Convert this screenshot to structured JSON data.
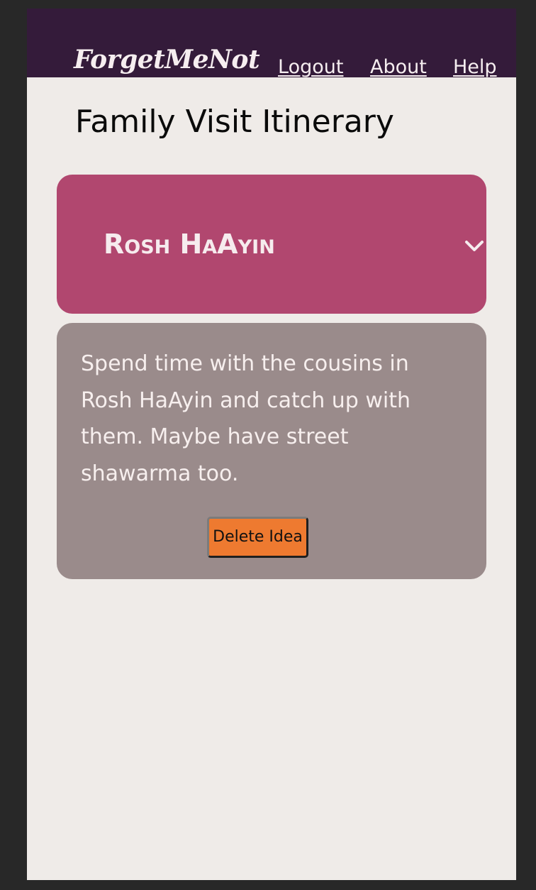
{
  "header": {
    "brand": "ForgetMeNot",
    "nav": {
      "logout": "Logout",
      "about": "About",
      "help": "Help"
    }
  },
  "page": {
    "title": "Family Visit Itinerary"
  },
  "accordion": {
    "title": "Rosh HaAyin",
    "icon": "chevron-down-icon",
    "expanded": true,
    "body_text": "Spend time with the cousins in Rosh HaAyin and catch up with them. Maybe have street shawarma too.",
    "delete_label": "Delete Idea"
  },
  "colors": {
    "navbar": "#341b3a",
    "page_background": "#efebe8",
    "accordion_header": "#b1476f",
    "accordion_body": "#9a8b8b",
    "delete_button": "#ee7a30"
  }
}
